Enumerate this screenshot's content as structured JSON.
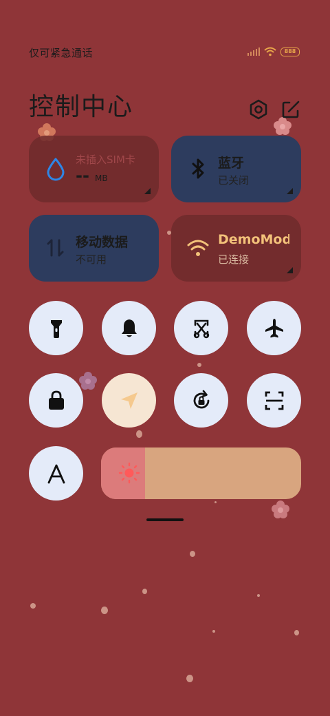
{
  "status_bar": {
    "carrier": "仅可紧急通话",
    "battery_label": "888"
  },
  "header": {
    "title": "控制中心",
    "icons": [
      "settings-icon",
      "edit-icon"
    ]
  },
  "tiles": {
    "sim": {
      "title": "未插入SIM卡",
      "value": "--",
      "unit": "MB",
      "icon": "water-drop-icon"
    },
    "bluetooth": {
      "title": "蓝牙",
      "status": "已关闭",
      "icon": "bluetooth-icon"
    },
    "mobile_data": {
      "title": "移动数据",
      "status": "不可用",
      "icon": "data-arrows-icon"
    },
    "wifi": {
      "title": "DemoMod",
      "status": "已连接",
      "icon": "wifi-icon"
    }
  },
  "toggles": [
    {
      "name": "flashlight",
      "icon": "flashlight-icon",
      "active": false
    },
    {
      "name": "ringer",
      "icon": "bell-icon",
      "active": false
    },
    {
      "name": "screenshot",
      "icon": "scissors-screenshot-icon",
      "active": false
    },
    {
      "name": "airplane",
      "icon": "airplane-icon",
      "active": false
    },
    {
      "name": "lock-screen",
      "icon": "lock-icon",
      "active": false
    },
    {
      "name": "location",
      "icon": "location-arrow-icon",
      "active": true
    },
    {
      "name": "rotation-lock",
      "icon": "rotation-lock-icon",
      "active": false
    },
    {
      "name": "scanner",
      "icon": "scan-icon",
      "active": false
    },
    {
      "name": "font",
      "icon": "font-a-icon",
      "active": false
    }
  ],
  "brightness": {
    "level": 0.22,
    "icon": "sun-icon"
  },
  "colors": {
    "background": "#8f3538",
    "button": "#e4ebf9",
    "active_button": "#f6e6d3",
    "active_tile": "#2d3c5e",
    "brightness_track": "#d8a57f",
    "brightness_fill": "#dc7b7b",
    "wifi_accent": "#f3c27a"
  }
}
